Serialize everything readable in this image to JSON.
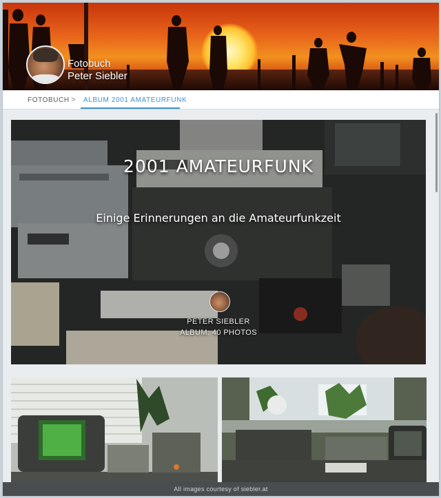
{
  "header": {
    "brand_line1": "Fotobuch",
    "brand_line2": "Peter Siebler"
  },
  "breadcrumb": {
    "items": [
      {
        "label": "FOTOBUCH"
      },
      {
        "label": "ALBUM 2001 AMATEURFUNK"
      }
    ],
    "separator": ">",
    "active_color": "#3d8fd0"
  },
  "hero": {
    "title": "2001 AMATEURFUNK",
    "subtitle": "Einige Erinnerungen an die Amateurfunkzeit",
    "author": "PETER SIEBLER",
    "photo_count": "ALBUM: 40 PHOTOS"
  },
  "footer": {
    "credit": "All images courtesy of siebler.at"
  }
}
